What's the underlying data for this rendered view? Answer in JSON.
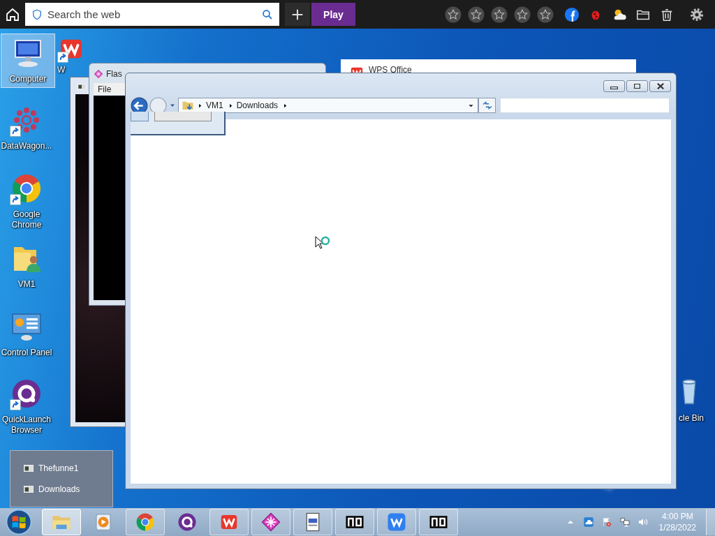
{
  "top_bar": {
    "search": {
      "placeholder": "Search the web"
    },
    "play_button": "Play"
  },
  "desktop_icons": [
    {
      "label": "Computer",
      "kind": "computer",
      "shortcut": false,
      "selected": true
    },
    {
      "label": "W",
      "kind": "office",
      "shortcut": true,
      "selected": false
    },
    {
      "label": "DataWagon...",
      "kind": "dots",
      "shortcut": true,
      "selected": false
    },
    {
      "label": "Google Chrome",
      "kind": "chrome",
      "shortcut": true,
      "selected": false
    },
    {
      "label": "VM1",
      "kind": "user_folder",
      "shortcut": false,
      "selected": false
    },
    {
      "label": "Control Panel",
      "kind": "control_panel",
      "shortcut": false,
      "selected": false
    },
    {
      "label": "QuickLaunch Browser",
      "kind": "quicklaunch",
      "shortcut": true,
      "selected": false
    },
    {
      "label": "cle Bin",
      "kind": "recycle_bin",
      "shortcut": false,
      "selected": false
    }
  ],
  "flash_window": {
    "title": "Flas",
    "menu": [
      "File"
    ]
  },
  "wps_window": {
    "title": "WPS Office"
  },
  "explorer_window": {
    "breadcrumb": [
      "VM1",
      "Downloads"
    ]
  },
  "jump_list": [
    "Thefunne1",
    "Downloads"
  ],
  "taskbar": [
    {
      "kind": "explorer",
      "running": true,
      "selected": true
    },
    {
      "kind": "media",
      "running": false,
      "selected": false
    },
    {
      "kind": "chrome",
      "running": true,
      "selected": false
    },
    {
      "kind": "quicklaunch",
      "running": false,
      "selected": false
    },
    {
      "kind": "office",
      "running": true,
      "selected": false
    },
    {
      "kind": "flash",
      "running": true,
      "selected": false
    },
    {
      "kind": "document",
      "running": true,
      "selected": false
    },
    {
      "kind": "archive",
      "running": true,
      "selected": false
    },
    {
      "kind": "office_blue",
      "running": true,
      "selected": false
    },
    {
      "kind": "archive",
      "running": true,
      "selected": false
    }
  ],
  "clock": {
    "time": "4:00 PM",
    "date": "1/28/2022"
  }
}
